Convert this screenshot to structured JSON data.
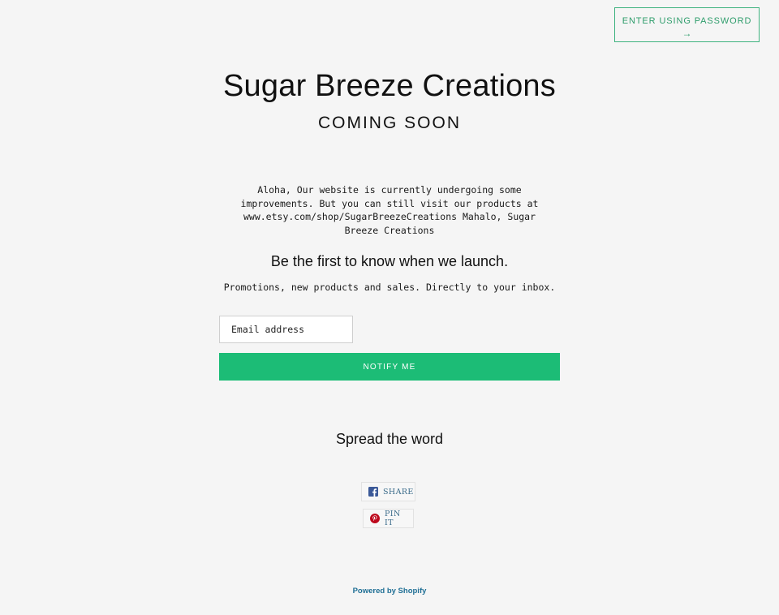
{
  "header": {
    "password_button_label": "ENTER USING PASSWORD",
    "password_button_arrow": "→"
  },
  "shop": {
    "title": "Sugar Breeze Creations",
    "status": "COMING SOON",
    "message": "Aloha, Our website is currently undergoing some improvements. But you can still visit our products at www.etsy.com/shop/SugarBreezeCreations Mahalo, Sugar Breeze Creations"
  },
  "signup": {
    "heading": "Be the first to know when we launch.",
    "subheading": "Promotions, new products and sales. Directly to your inbox.",
    "email_placeholder": "Email address",
    "email_value": "",
    "submit_label": "NOTIFY ME"
  },
  "social": {
    "heading": "Spread the word",
    "facebook_label": "SHARE",
    "pinterest_label": "PIN IT",
    "facebook_icon": "facebook-icon",
    "pinterest_icon": "pinterest-icon"
  },
  "footer": {
    "powered_by": "Powered by Shopify"
  },
  "colors": {
    "accent": "#1cbc76",
    "password_border": "#3fb37f",
    "link": "#1f6f95",
    "facebook": "#3b5998",
    "pinterest": "#bd081c",
    "background": "#f5f5f5"
  }
}
